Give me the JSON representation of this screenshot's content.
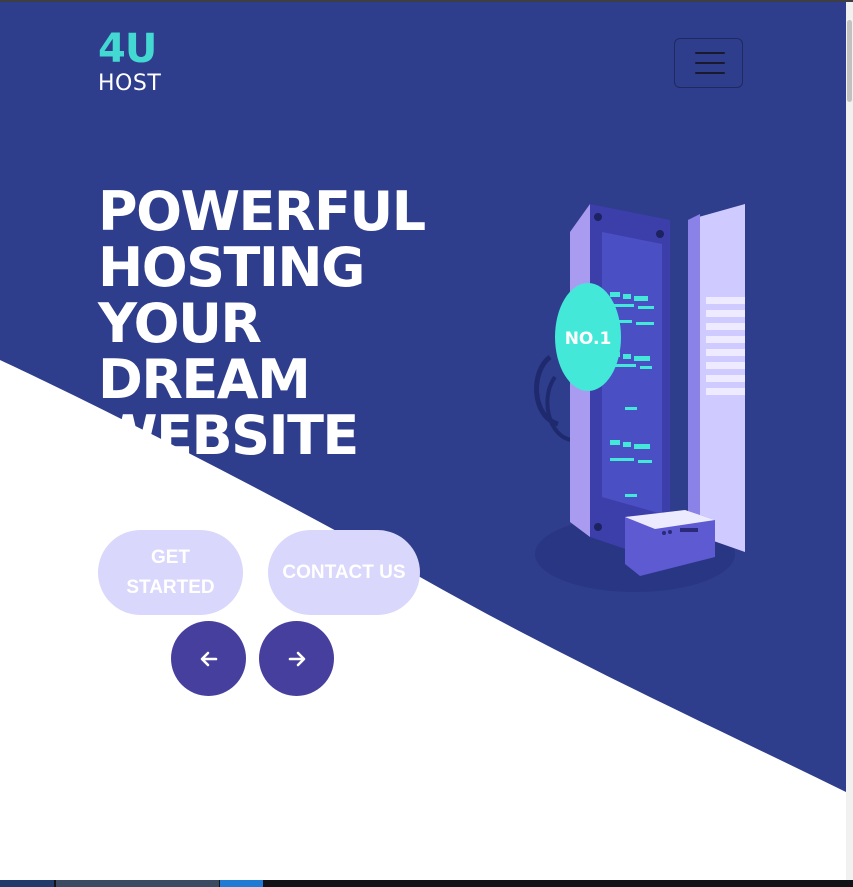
{
  "brand": {
    "name_main": "4U",
    "name_sub": "HOST"
  },
  "nav": {
    "toggle_icon": "hamburger-menu-icon"
  },
  "hero": {
    "headline_lines": [
      "POWERFUL",
      "HOSTING",
      "YOUR",
      "DREAM",
      "WEBSITE"
    ],
    "buttons": {
      "get_started": "GET STARTED",
      "contact_us": "CONTACT US"
    },
    "slider": {
      "prev_icon": "arrow-left-icon",
      "next_icon": "arrow-right-icon"
    },
    "illustration": {
      "badge_text": "NO.1",
      "icon": "server-rack-illustration"
    }
  },
  "colors": {
    "hero_background": "#2e3d8c",
    "logo_accent": "#43d9d2",
    "button_pill": "#d9d7fb",
    "round_button": "#463f9e",
    "badge": "#43e8d8"
  }
}
